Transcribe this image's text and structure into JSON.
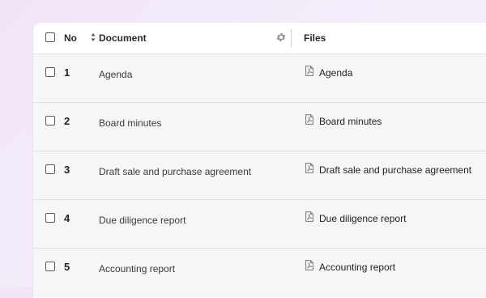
{
  "table": {
    "headers": {
      "no": "No",
      "document": "Document",
      "files": "Files"
    },
    "rows": [
      {
        "no": "1",
        "document": "Agenda",
        "file": "Agenda"
      },
      {
        "no": "2",
        "document": "Board minutes",
        "file": "Board minutes"
      },
      {
        "no": "3",
        "document": "Draft sale and purchase agreement",
        "file": "Draft sale and purchase agreement"
      },
      {
        "no": "4",
        "document": "Due diligence report",
        "file": "Due diligence report"
      },
      {
        "no": "5",
        "document": "Accounting report",
        "file": "Accounting report"
      }
    ]
  },
  "icons": {
    "sort": "sort-icon",
    "settings": "gear-icon",
    "file": "pdf-file-icon"
  },
  "colors": {
    "background": "#f3ebf9",
    "card": "#ffffff",
    "row": "#f6f6f6",
    "divider": "#e2e2e2"
  }
}
